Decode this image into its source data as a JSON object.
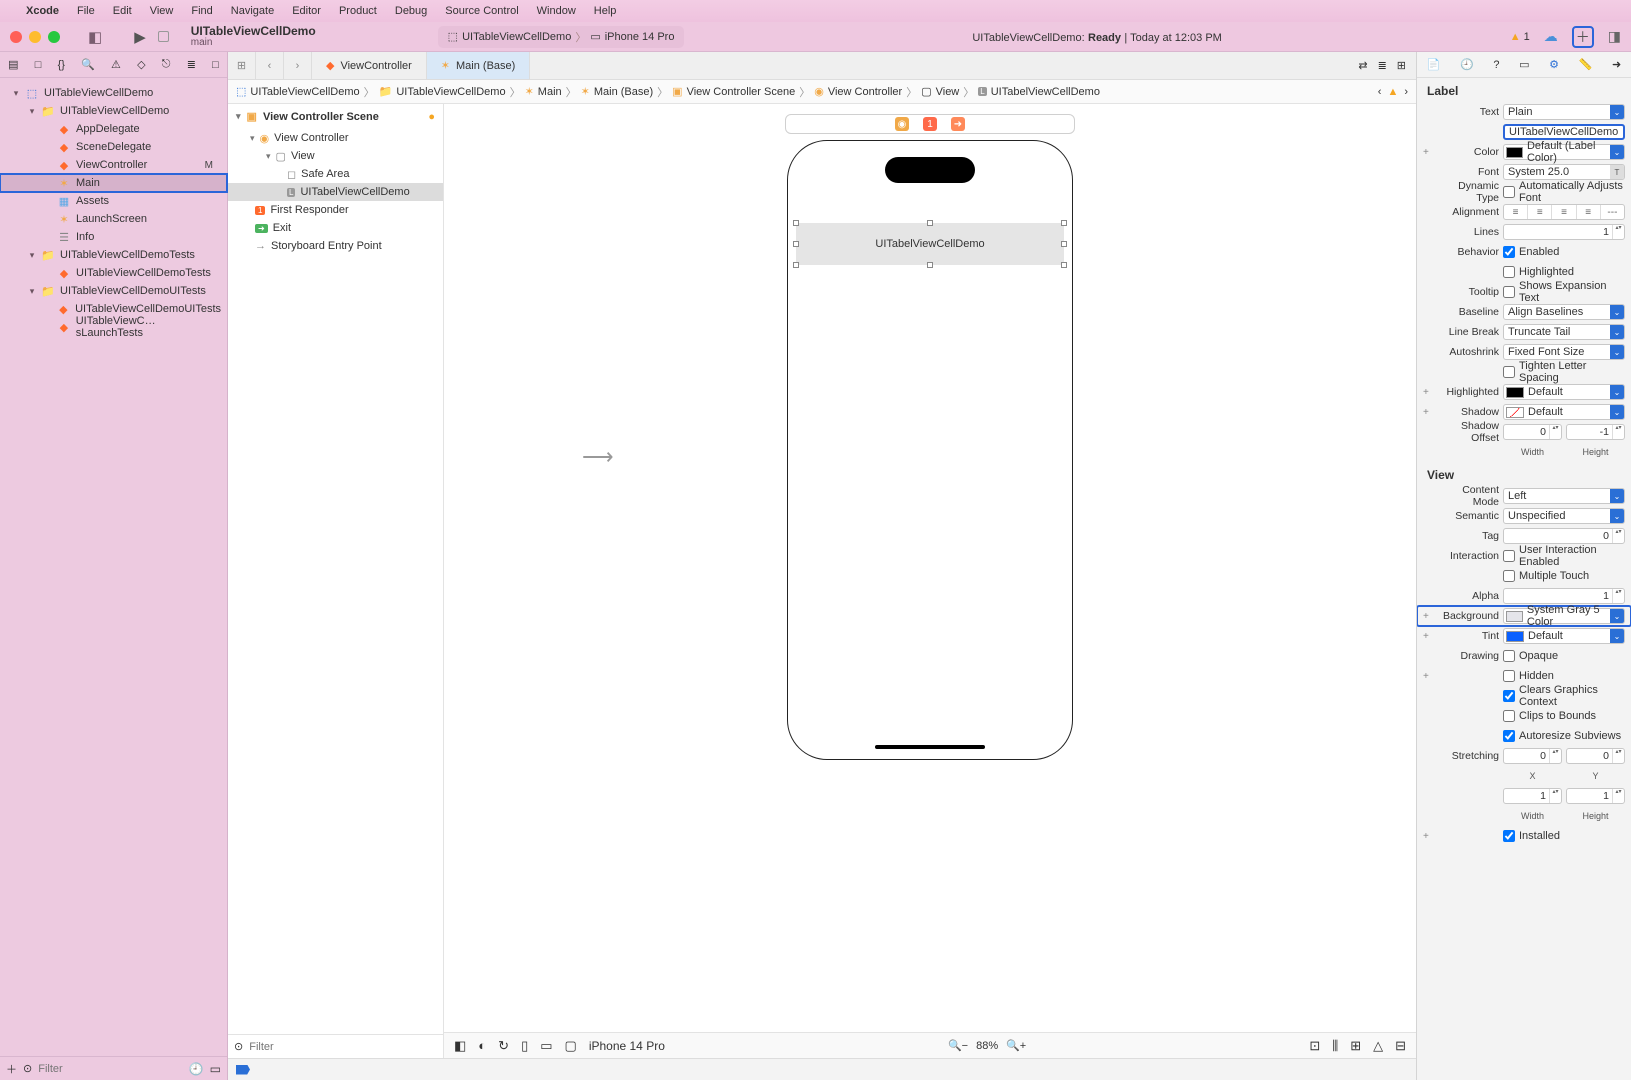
{
  "menu": {
    "apple": "",
    "app": "Xcode",
    "items": [
      "File",
      "Edit",
      "View",
      "Find",
      "Navigate",
      "Editor",
      "Product",
      "Debug",
      "Source Control",
      "Window",
      "Help"
    ]
  },
  "toolbar": {
    "project": "UITableViewCellDemo",
    "branch": "main",
    "scheme": "UITableViewCellDemo",
    "destination": "iPhone 14 Pro",
    "status_prefix": "UITableViewCellDemo:",
    "status_state": "Ready",
    "status_time": "Today at 12:03 PM",
    "warn_count": "1"
  },
  "nav_icons": [
    "▤",
    "□",
    "{}",
    "⚠",
    "◇",
    "⎋",
    "≣",
    "□",
    "▭"
  ],
  "tree": {
    "root": "UITableViewCellDemo",
    "g1": "UITableViewCellDemo",
    "appdel": "AppDelegate",
    "scenedel": "SceneDelegate",
    "vc": "ViewController",
    "vc_badge": "M",
    "main": "Main",
    "assets": "Assets",
    "launch": "LaunchScreen",
    "info": "Info",
    "g2": "UITableViewCellDemoTests",
    "g2a": "UITableViewCellDemoTests",
    "g3": "UITableViewCellDemoUITests",
    "g3a": "UITableViewCellDemoUITests",
    "g3b": "UITableViewC…sLaunchTests"
  },
  "nav_filter_ph": "Filter",
  "tabs": {
    "t1": "ViewController",
    "t2": "Main (Base)"
  },
  "jump": [
    "UITableViewCellDemo",
    "UITableViewCellDemo",
    "Main",
    "Main (Base)",
    "View Controller Scene",
    "View Controller",
    "View",
    "UITabelViewCellDemo"
  ],
  "outline": {
    "head": "View Controller Scene",
    "vc": "View Controller",
    "view": "View",
    "sa": "Safe Area",
    "label": "UITabelViewCellDemo",
    "fr": "First Responder",
    "exit": "Exit",
    "ep": "Storyboard Entry Point",
    "filter_ph": "Filter"
  },
  "canvas": {
    "label_text": "UITabelViewCellDemo",
    "device": "iPhone 14 Pro",
    "zoom": "88%"
  },
  "inspector": {
    "label_head": "Label",
    "text_type": "Plain",
    "text_val": "UITabelViewCellDemo",
    "color": "Default (Label Color)",
    "font": "System 25.0",
    "dyntype": "Automatically Adjusts Font",
    "lines": "1",
    "enabled": "Enabled",
    "highlighted_b": "Highlighted",
    "tooltip": "Shows Expansion Text",
    "baseline": "Align Baselines",
    "linebreak": "Truncate Tail",
    "autoshrink": "Fixed Font Size",
    "tighten": "Tighten Letter Spacing",
    "hilite": "Default",
    "shadow": "Default",
    "so_w": "0",
    "so_h": "-1",
    "so_wl": "Width",
    "so_hl": "Height",
    "view_head": "View",
    "cmode": "Left",
    "semantic": "Unspecified",
    "tag": "0",
    "uie": "User Interaction Enabled",
    "mtouch": "Multiple Touch",
    "alpha": "1",
    "bg": "System Gray 5 Color",
    "tint": "Default",
    "opaque": "Opaque",
    "hidden": "Hidden",
    "cgc": "Clears Graphics Context",
    "ctb": "Clips to Bounds",
    "asv": "Autoresize Subviews",
    "st_x": "0",
    "st_y": "0",
    "st_xl": "X",
    "st_yl": "Y",
    "st_w": "1",
    "st_h": "1",
    "st_wl": "Width",
    "st_hl": "Height",
    "installed": "Installed",
    "labels": {
      "text": "Text",
      "color": "Color",
      "font": "Font",
      "dyntype": "Dynamic Type",
      "align": "Alignment",
      "lines": "Lines",
      "behavior": "Behavior",
      "tooltip": "Tooltip",
      "baseline": "Baseline",
      "linebreak": "Line Break",
      "autoshrink": "Autoshrink",
      "hilite": "Highlighted",
      "shadow": "Shadow",
      "shadowoff": "Shadow Offset",
      "cmode": "Content Mode",
      "semantic": "Semantic",
      "tag": "Tag",
      "interaction": "Interaction",
      "alpha": "Alpha",
      "bg": "Background",
      "tint": "Tint",
      "drawing": "Drawing",
      "stretch": "Stretching"
    }
  }
}
